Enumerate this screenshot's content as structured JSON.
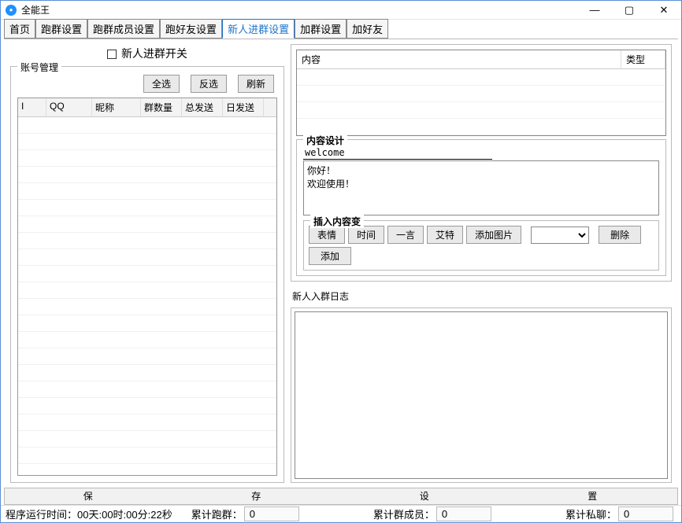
{
  "window": {
    "title": "全能王"
  },
  "tabs": [
    {
      "label": "首页"
    },
    {
      "label": "跑群设置"
    },
    {
      "label": "跑群成员设置"
    },
    {
      "label": "跑好友设置"
    },
    {
      "label": "新人进群设置",
      "active": true
    },
    {
      "label": "加群设置"
    },
    {
      "label": "加好友"
    }
  ],
  "switch": {
    "label": "新人进群开关"
  },
  "account_box": {
    "legend": "账号管理",
    "buttons": {
      "select_all": "全选",
      "invert": "反选",
      "refresh": "刷新"
    },
    "columns": {
      "i": "I",
      "qq": "QQ",
      "nick": "昵称",
      "gcnt": "群数量",
      "total_send": "总发送",
      "day_send": "日发送"
    }
  },
  "content_list": {
    "columns": {
      "content": "内容",
      "type": "类型"
    }
  },
  "content_set": {
    "legend": "内容设计",
    "welcome": "welcome",
    "body": "你好！\n欢迎使用！"
  },
  "insert_vars": {
    "legend": "插入内容变",
    "buttons": {
      "emoji": "表情",
      "time": "时间",
      "yiyan": "一言",
      "at": "艾特",
      "add_img": "添加图片",
      "delete": "删除",
      "add": "添加"
    }
  },
  "log": {
    "label": "新人入群日志"
  },
  "savebar": {
    "a": "保",
    "b": "存",
    "c": "设",
    "d": "置"
  },
  "status": {
    "runtime_label": "程序运行时间：",
    "runtime_value": "00天:00时:00分:22秒",
    "run_group_label": "累计跑群：",
    "run_group_value": "0",
    "group_member_label": "累计群成员：",
    "group_member_value": "0",
    "pm_label": "累计私聊：",
    "pm_value": "0"
  }
}
